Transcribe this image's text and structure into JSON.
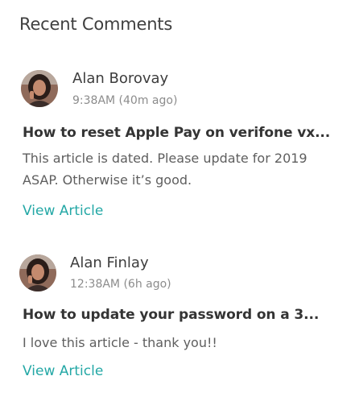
{
  "panel": {
    "title": "Recent Comments"
  },
  "colors": {
    "accent": "#24a8a6",
    "muted": "#8c8c8c"
  },
  "comments": [
    {
      "author": "Alan Borovay",
      "time": "9:38AM (40m ago)",
      "article_title": "How to reset Apple Pay on verifone vx...",
      "text": "This article is dated. Please update for 2019 ASAP. Otherwise it’s good.",
      "link_label": "View Article",
      "avatar_icon": "user-avatar"
    },
    {
      "author": "Alan Finlay",
      "time": "12:38AM (6h ago)",
      "article_title": "How to update your password on a 3...",
      "text": "I love this article - thank you!!",
      "link_label": "View Article",
      "avatar_icon": "user-avatar"
    }
  ]
}
